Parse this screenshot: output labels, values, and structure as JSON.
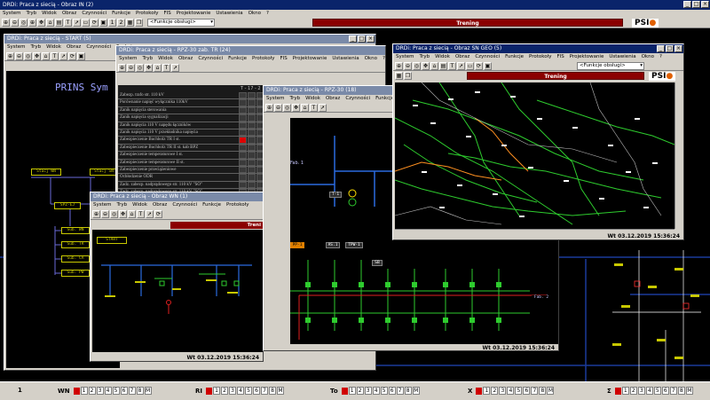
{
  "app": {
    "main_title": "DRDi: Praca z siecią - Obraz IN (2)",
    "menu": [
      "System",
      "Tryb",
      "Widok",
      "Obraz",
      "Czynności",
      "Funkcje",
      "Protokoły",
      "FIS",
      "Projektowanie",
      "Ustawienia",
      "Okno",
      "?"
    ],
    "combo_value": "<Funkcje obsługi>",
    "trening_label": "Trening",
    "logo": "PSI",
    "toolbar_numbers": [
      "1",
      "2"
    ]
  },
  "windows": {
    "start": {
      "title": "DRDi: Praca z siecią - START (5)",
      "menu": [
        "System",
        "Tryb",
        "Widok",
        "Obraz",
        "Czynności",
        "Funkcje"
      ],
      "heading": "PRINS Sym",
      "boxes": [
        "Stacj WN",
        "Stacj SN",
        "SPZ-EJ",
        "Sub. WN",
        "Sub. TR",
        "Sub. CA",
        "Sub. PW"
      ]
    },
    "rpz_list": {
      "title": "DRDi: Praca z siecią - RPZ-30 zab. TR (24)",
      "menu": [
        "System",
        "Tryb",
        "Widok",
        "Obraz",
        "Czynności",
        "Funkcje",
        "Protokoły",
        "FIS",
        "Projektowanie",
        "Ustawienia",
        "Okno",
        "?"
      ],
      "col_header": "T - 17 - 2",
      "rows": [
        "Zabezp. trafo str. 110 kV",
        "Porównanie napięć wyłącznika 110kV",
        "Zanik napięcia sterowania",
        "Zanik napięcia sygnalizacji",
        "Zanik napięcia 110 V napędu łączników",
        "Zanik napięcia 110 V przekładnika napięcia",
        "Zabezpieczenie Buchholz TR I st.",
        "Zabezpieczenie Buchholz TR II st. kab BPZ",
        "Zabezpieczenie temperaturowe I st.",
        "Zabezpieczenie temperaturowe II st.",
        "Zabezpieczenie przeciążeniowe",
        "Ochłodzenie ODR",
        "Zadz. zabezp. nadprądowego str. 110 kV \"SO\"",
        "Zadz. zabezp. nadprądowego str. 110 kV \"SO\"",
        "Uruchomienie APO/ Uruchom. / Odstaw."
      ]
    },
    "rpz30": {
      "title": "DRDi: Praca z siecią - RPZ-30 (18)",
      "menu": [
        "System",
        "Tryb",
        "Widok",
        "Obraz",
        "Czynności",
        "Funkcje",
        "Protokoły"
      ],
      "labels": [
        "Fab. 1",
        "T-1",
        "T-1",
        "PP-1",
        "AS.1",
        "TPW-1",
        "AS.2",
        "TPW-2",
        "PP-2",
        "SB",
        "Fab. 2"
      ],
      "status_time": "Wt 03.12.2019 15:36:24"
    },
    "wn": {
      "title": "DRDi: Praca z siecią - Obraz WN (1)",
      "menu": [
        "System",
        "Tryb",
        "Widok",
        "Obraz",
        "Czynności",
        "Funkcje",
        "Protokoły"
      ],
      "trening": "Treni",
      "start_box": "START",
      "status_time": "Wt 03.12.2019 15:36:24"
    },
    "geo": {
      "title": "DRDi: Praca z siecią - Obraz SN GEO (5)",
      "menu": [
        "System",
        "Tryb",
        "Widok",
        "Obraz",
        "Czynności",
        "Funkcje",
        "Protokoły",
        "FIS",
        "Projektowanie",
        "Ustawienia",
        "Okno",
        "?"
      ],
      "combo_value": "<Funkcje obsługi>",
      "trening_label": "Trening",
      "status_time": "Wt 03.12.2019 15:36:24"
    }
  },
  "bottom_pages": [
    {
      "label": "1",
      "nums": []
    },
    {
      "label": "WN",
      "nums": [
        "1",
        "2",
        "3",
        "4",
        "5",
        "6",
        "7",
        "8",
        "M"
      ]
    },
    {
      "label": "RI",
      "nums": [
        "1",
        "2",
        "3",
        "4",
        "5",
        "6",
        "7",
        "8",
        "M"
      ]
    },
    {
      "label": "To",
      "nums": [
        "1",
        "2",
        "3",
        "4",
        "5",
        "6",
        "7",
        "8",
        "M"
      ]
    },
    {
      "label": "X",
      "nums": [
        "1",
        "2",
        "3",
        "4",
        "5",
        "6",
        "7",
        "8",
        "M"
      ]
    },
    {
      "label": "Σ",
      "nums": [
        "1",
        "2",
        "3",
        "4",
        "5",
        "6",
        "7",
        "8",
        "M"
      ]
    }
  ],
  "colors": {
    "title_active": "#0a246a",
    "trening": "#8b0000",
    "geo_lines": "#2ecc2e",
    "labels": "#c8c800"
  }
}
